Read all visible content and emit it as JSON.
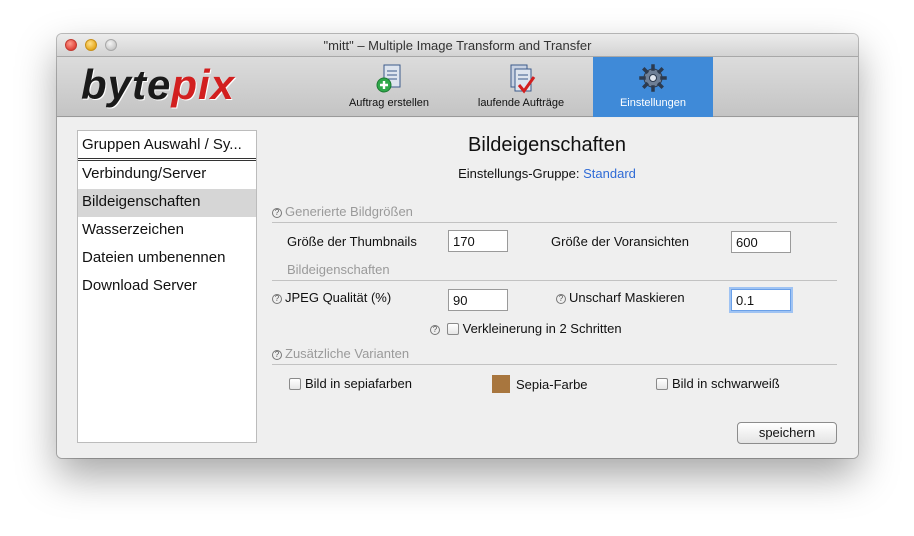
{
  "window": {
    "title": "\"mitt\" – Multiple Image Transform and Transfer"
  },
  "logo": {
    "part1": "byte",
    "part2": "pix"
  },
  "toolbar": {
    "items": [
      {
        "label": "Auftrag erstellen",
        "icon": "new-job-icon",
        "active": false
      },
      {
        "label": "laufende Aufträge",
        "icon": "running-jobs-icon",
        "active": false
      },
      {
        "label": "Einstellungen",
        "icon": "settings-gear-icon",
        "active": true
      }
    ]
  },
  "sidebar": {
    "header": "Gruppen Auswahl / Sy...",
    "items": [
      {
        "label": "Verbindung/Server"
      },
      {
        "label": "Bildeigenschaften",
        "selected": true
      },
      {
        "label": "Wasserzeichen"
      },
      {
        "label": "Dateien umbenennen"
      },
      {
        "label": "Download Server"
      }
    ]
  },
  "main": {
    "title": "Bildeigenschaften",
    "group_label": "Einstellungs-Gruppe:",
    "group_value": "Standard",
    "sections": {
      "generated": "Generierte Bildgrößen",
      "props": "Bildeigenschaften",
      "variants": "Zusätzliche Varianten"
    },
    "thumb_label": "Größe der Thumbnails",
    "thumb_value": "170",
    "preview_label": "Größe der Voransichten",
    "preview_value": "600",
    "jpeg_label": "JPEG Qualität (%)",
    "jpeg_value": "90",
    "unsharp_label": "Unscharf Maskieren",
    "unsharp_value": "0.1",
    "two_step_label": "Verkleinerung in 2 Schritten",
    "sepia_label": "Bild in sepiafarben",
    "sepia_color_label": "Sepia-Farbe",
    "sepia_color": "#a8763e",
    "bw_label": "Bild in schwarweiß",
    "save_label": "speichern"
  },
  "colors": {
    "accent": "#3f8ad8",
    "link": "#2f6bd6"
  }
}
